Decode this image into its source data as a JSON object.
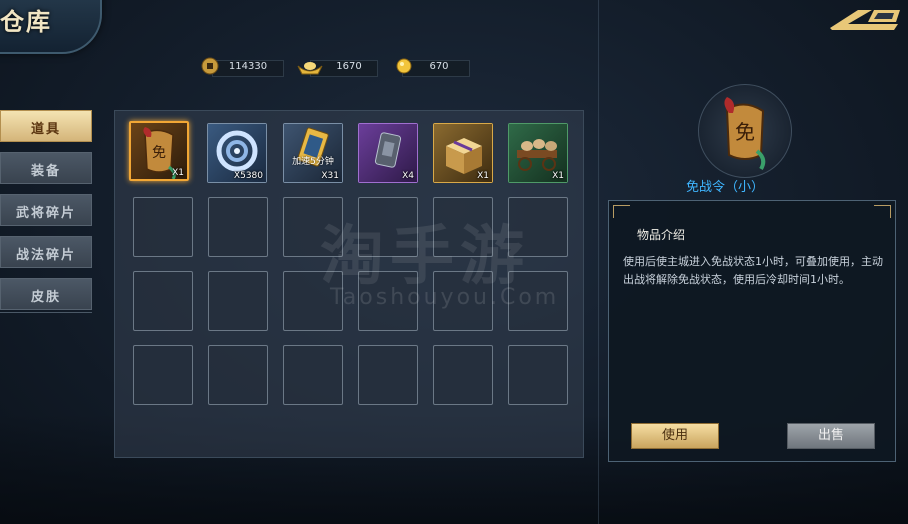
{
  "header": {
    "title": "仓库"
  },
  "currencies": [
    {
      "icon": "copper-coin-icon",
      "value": "114330"
    },
    {
      "icon": "gold-ingot-icon",
      "value": "1670"
    },
    {
      "icon": "gold-coin-icon",
      "value": "670"
    }
  ],
  "sidebar": {
    "items": [
      {
        "label": "道具",
        "active": true
      },
      {
        "label": "装备",
        "active": false
      },
      {
        "label": "武将碎片",
        "active": false
      },
      {
        "label": "战法碎片",
        "active": false
      },
      {
        "label": "皮肤",
        "active": false
      }
    ]
  },
  "inventory": {
    "items": [
      {
        "icon": "truce-scroll-icon",
        "qty": "X1",
        "rarity": "orange"
      },
      {
        "icon": "jade-cloud-icon",
        "qty": "X5380",
        "rarity": "blue"
      },
      {
        "icon": "speedup-token-icon",
        "qty": "X31",
        "rarity": "blue",
        "text": "加速5分钟"
      },
      {
        "icon": "tablet-icon",
        "qty": "X4",
        "rarity": "purple"
      },
      {
        "icon": "gift-box-icon",
        "qty": "X1",
        "rarity": "orange"
      },
      {
        "icon": "supply-cart-icon",
        "qty": "X1",
        "rarity": "green"
      }
    ],
    "empty_slots": 18
  },
  "watermark": {
    "main": "淘手游",
    "sub": "Taoshouyou.Com"
  },
  "detail": {
    "name": "免战令（小）",
    "icon_char": "免",
    "intro_title": "物品介绍",
    "description": "使用后使主城进入免战状态1小时，可叠加使用，主动出战将解除免战状态，使用后冷却时间1小时。",
    "use_label": "使用",
    "sell_label": "出售"
  },
  "colors": {
    "accent": "#f2a735",
    "name": "#3fb6ff"
  }
}
